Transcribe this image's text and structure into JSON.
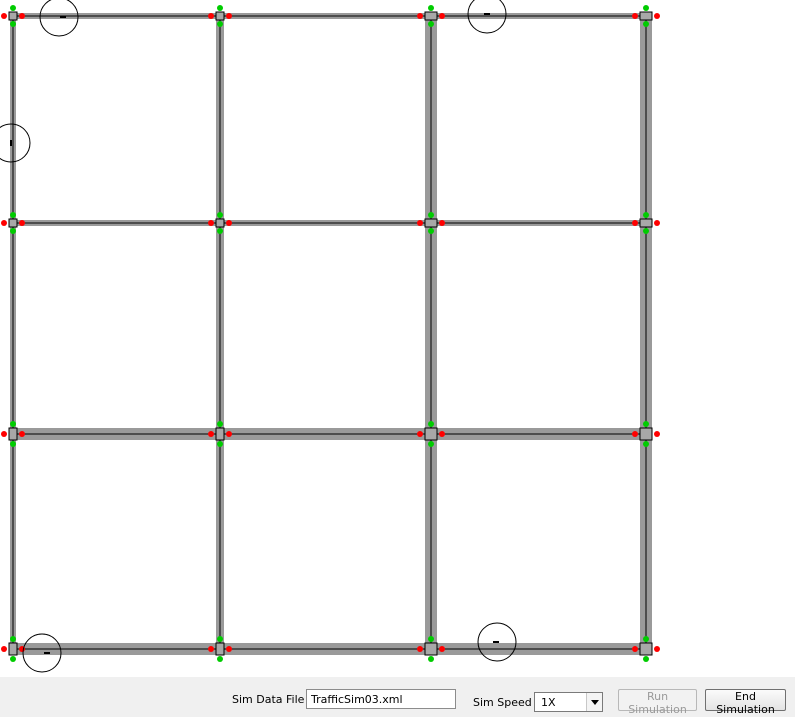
{
  "controls": {
    "file_label": "Sim Data File",
    "file_value": "TrafficSim03.xml",
    "speed_label": "Sim Speed",
    "speed_value": "1X",
    "run_label": "Run Simulation",
    "end_label": "End Simulation"
  },
  "colors": {
    "road_fill": "#9a9a9a",
    "lane_line": "#000000",
    "signal_red": "#ff0000",
    "signal_green": "#00cc00",
    "intersection_fill": "#a8a8a8",
    "vehicle_circle": "#000000"
  }
}
